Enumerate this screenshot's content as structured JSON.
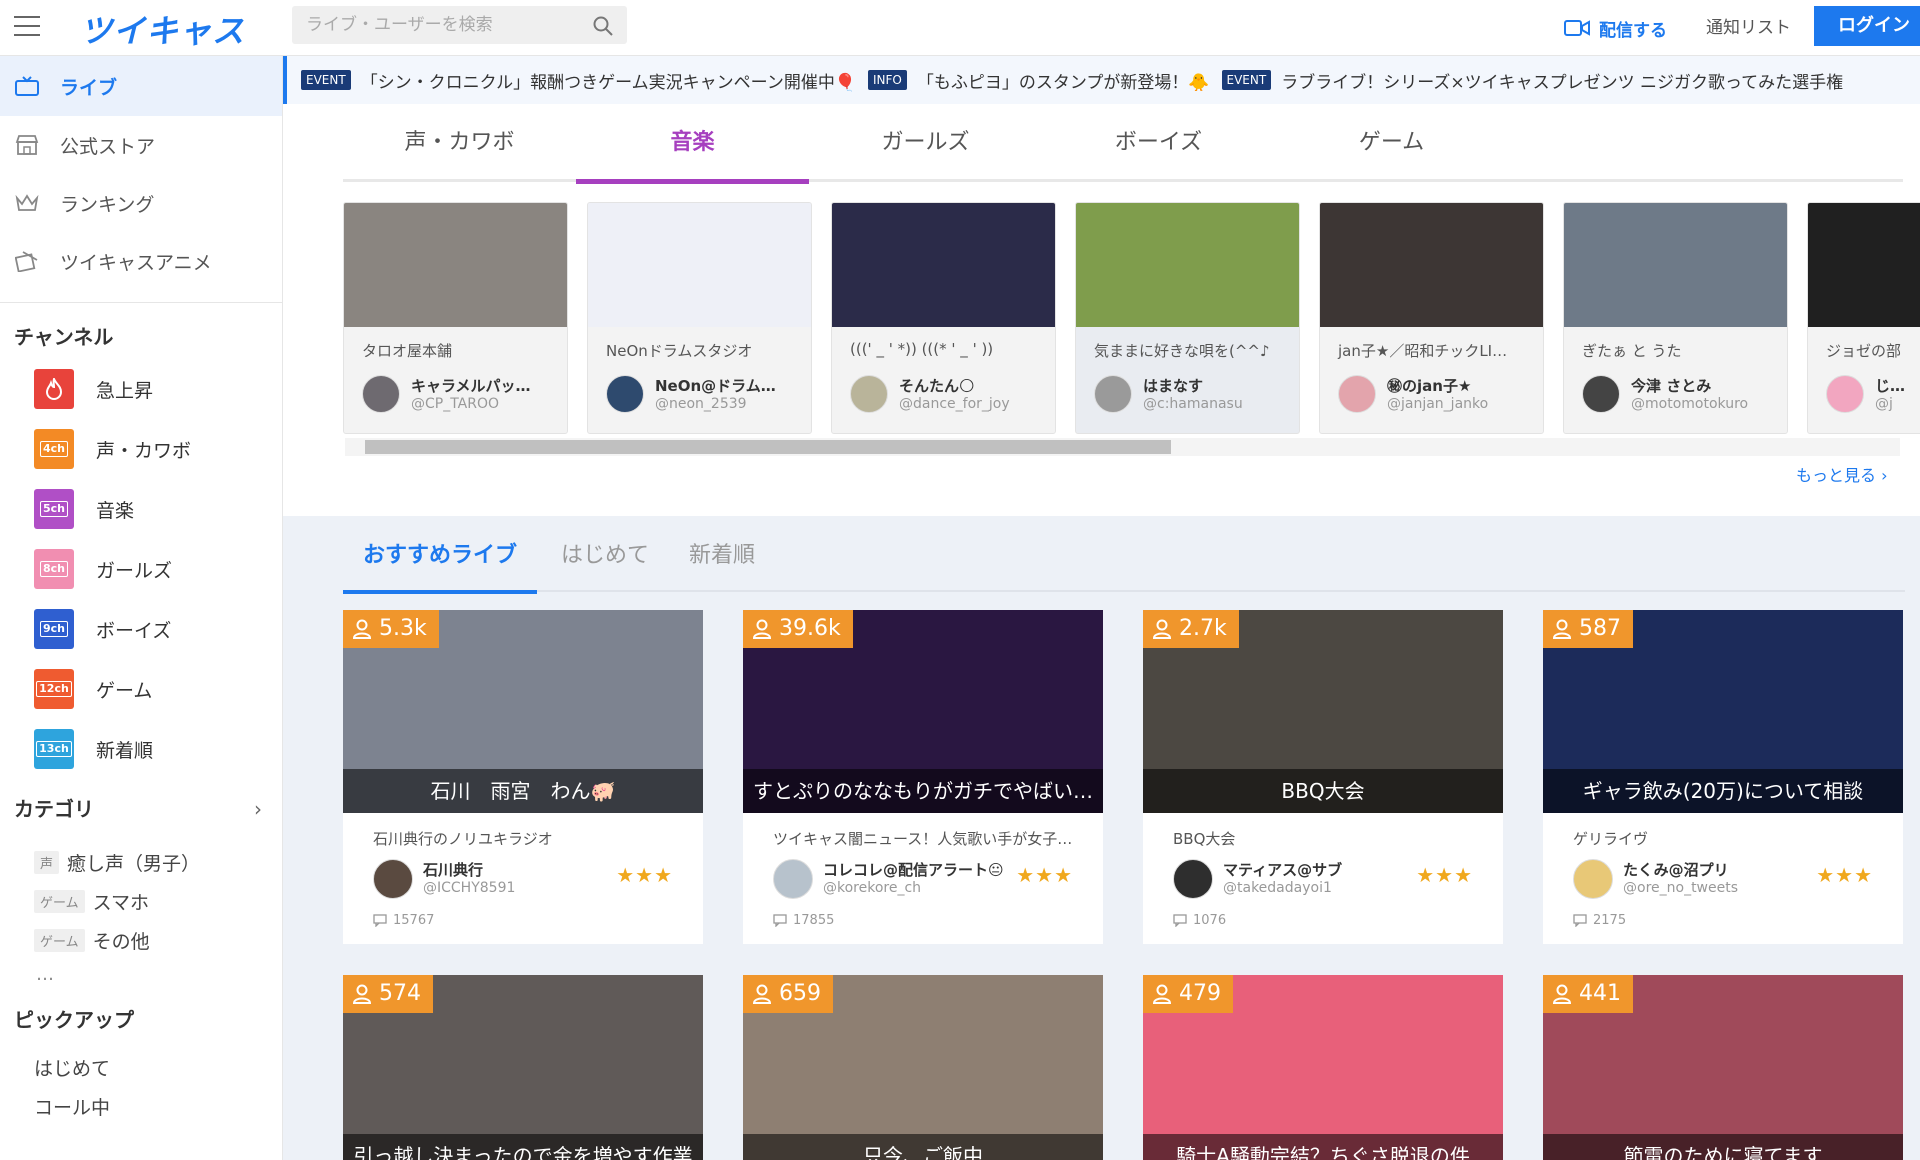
{
  "header": {
    "logo": "ツイキャス",
    "search_placeholder": "ライブ・ユーザーを検索",
    "broadcast_label": "配信する",
    "notify_label": "通知リスト",
    "login_label": "ログイン"
  },
  "sidebar": {
    "nav": [
      {
        "label": "ライブ"
      },
      {
        "label": "公式ストア"
      },
      {
        "label": "ランキング"
      },
      {
        "label": "ツイキャスアニメ"
      }
    ],
    "channels_heading": "チャンネル",
    "channels": [
      {
        "label": "急上昇",
        "badge": "",
        "color": "#e8433b"
      },
      {
        "label": "声・カワボ",
        "badge": "4ch",
        "color": "#f38a25"
      },
      {
        "label": "音楽",
        "badge": "5ch",
        "color": "#b04fc6"
      },
      {
        "label": "ガールズ",
        "badge": "8ch",
        "color": "#f18eb1"
      },
      {
        "label": "ボーイズ",
        "badge": "9ch",
        "color": "#2f5fd0"
      },
      {
        "label": "ゲーム",
        "badge": "12ch",
        "color": "#ef5b30"
      },
      {
        "label": "新着順",
        "badge": "13ch",
        "color": "#2ea4dd"
      }
    ],
    "category_heading": "カテゴリ",
    "categories": [
      {
        "tag": "声",
        "label": "癒し声（男子）"
      },
      {
        "tag": "ゲーム",
        "label": "スマホ"
      },
      {
        "tag": "ゲーム",
        "label": "その他"
      }
    ],
    "more": "…",
    "pickup_heading": "ピックアップ",
    "pickup": [
      {
        "label": "はじめて"
      },
      {
        "label": "コール中"
      }
    ]
  },
  "ticker": [
    {
      "tag": "EVENT",
      "text": "「シン・クロニクル」報酬つきゲーム実況キャンペーン開催中🎈"
    },
    {
      "tag": "INFO",
      "text": "「もふピヨ」のスタンプが新登場！🐥"
    },
    {
      "tag": "EVENT",
      "text": "ラブライブ！シリーズ×ツイキャスプレゼンツ ニジガク歌ってみた選手権"
    }
  ],
  "genre_tabs": [
    "声・カワボ",
    "音楽",
    "ガールズ",
    "ボーイズ",
    "ゲーム"
  ],
  "carousel": [
    {
      "title": "タロオ屋本舗",
      "name": "キャラメルパッ…",
      "id": "@CP_TAROO",
      "thumb": "#8a8580",
      "avatar": "#6e6a70"
    },
    {
      "title": "NeOnドラムスタジオ",
      "name": "NeOn@ドラム…",
      "id": "@neon_2539",
      "thumb": "#eef0f7",
      "avatar": "#2e4a6e"
    },
    {
      "title": "(((' _ ' *)) (((* ' _ ' ))",
      "name": "そんたん🌕",
      "id": "@dance_for_joy",
      "thumb": "#2b2b49",
      "avatar": "#b9b49a"
    },
    {
      "title": "気ままに好きな唄を(^^♪",
      "name": "はまなす",
      "id": "@c:hamanasu",
      "thumb": "#7f9d4c",
      "avatar": "#9a9a9a"
    },
    {
      "title": "jan子★／昭和チックLI…",
      "name": "㊙のjan子★",
      "id": "@janjan_janko",
      "thumb": "#3d3634",
      "avatar": "#e3a4ac"
    },
    {
      "title": "ぎたぁ と うた",
      "name": "今津 さとみ",
      "id": "@motomotokuro",
      "thumb": "#6e7a88",
      "avatar": "#444444"
    },
    {
      "title": "ジョゼの部",
      "name": "じ…",
      "id": "@j",
      "thumb": "#202020",
      "avatar": "#f2a6c0"
    }
  ],
  "more_link": "もっと見る",
  "sub_tabs": [
    "おすすめライブ",
    "はじめて",
    "新着順"
  ],
  "live": [
    {
      "viewers": "5.3k",
      "caption": "石川　雨宮　わん🐖",
      "sub": "石川典行のノリユキラジオ",
      "name": "石川典行",
      "id": "@ICCHY8591",
      "comments": "15767",
      "thumb": "#7d8390",
      "avatar": "#5a4a40"
    },
    {
      "viewers": "39.6k",
      "caption": "すとぷりのななもりがガチでやばい…",
      "sub": "ツイキャス闇ニュース！人気歌い手が女子…",
      "name": "コレコレ@配信アラート😐",
      "id": "@korekore_ch",
      "comments": "17855",
      "thumb": "#2a1741",
      "avatar": "#b7c2cc"
    },
    {
      "viewers": "2.7k",
      "caption": "BBQ大会",
      "sub": "BBQ大会",
      "name": "マティアス@サブ",
      "id": "@takedadayoi1",
      "comments": "1076",
      "thumb": "#4c4842",
      "avatar": "#2e2e2e"
    },
    {
      "viewers": "587",
      "caption": "ギャラ飲み(20万)について相談",
      "sub": "ゲリライヴ",
      "name": "たくみ@沼プリ",
      "id": "@ore_no_tweets",
      "comments": "2175",
      "thumb": "#1c2b5a",
      "avatar": "#e8c877"
    },
    {
      "viewers": "574",
      "caption": "引っ越し決まったので金を増やす作業",
      "thumb": "#605a58"
    },
    {
      "viewers": "659",
      "caption": "只今、ご飯中",
      "thumb": "#8e7f72"
    },
    {
      "viewers": "479",
      "caption": "騎士A騒動完結？ちぐさ脱退の件",
      "thumb": "#e8607a"
    },
    {
      "viewers": "441",
      "caption": "節電のために寝てます",
      "thumb": "#a04a5a"
    }
  ],
  "stars": "★★★"
}
